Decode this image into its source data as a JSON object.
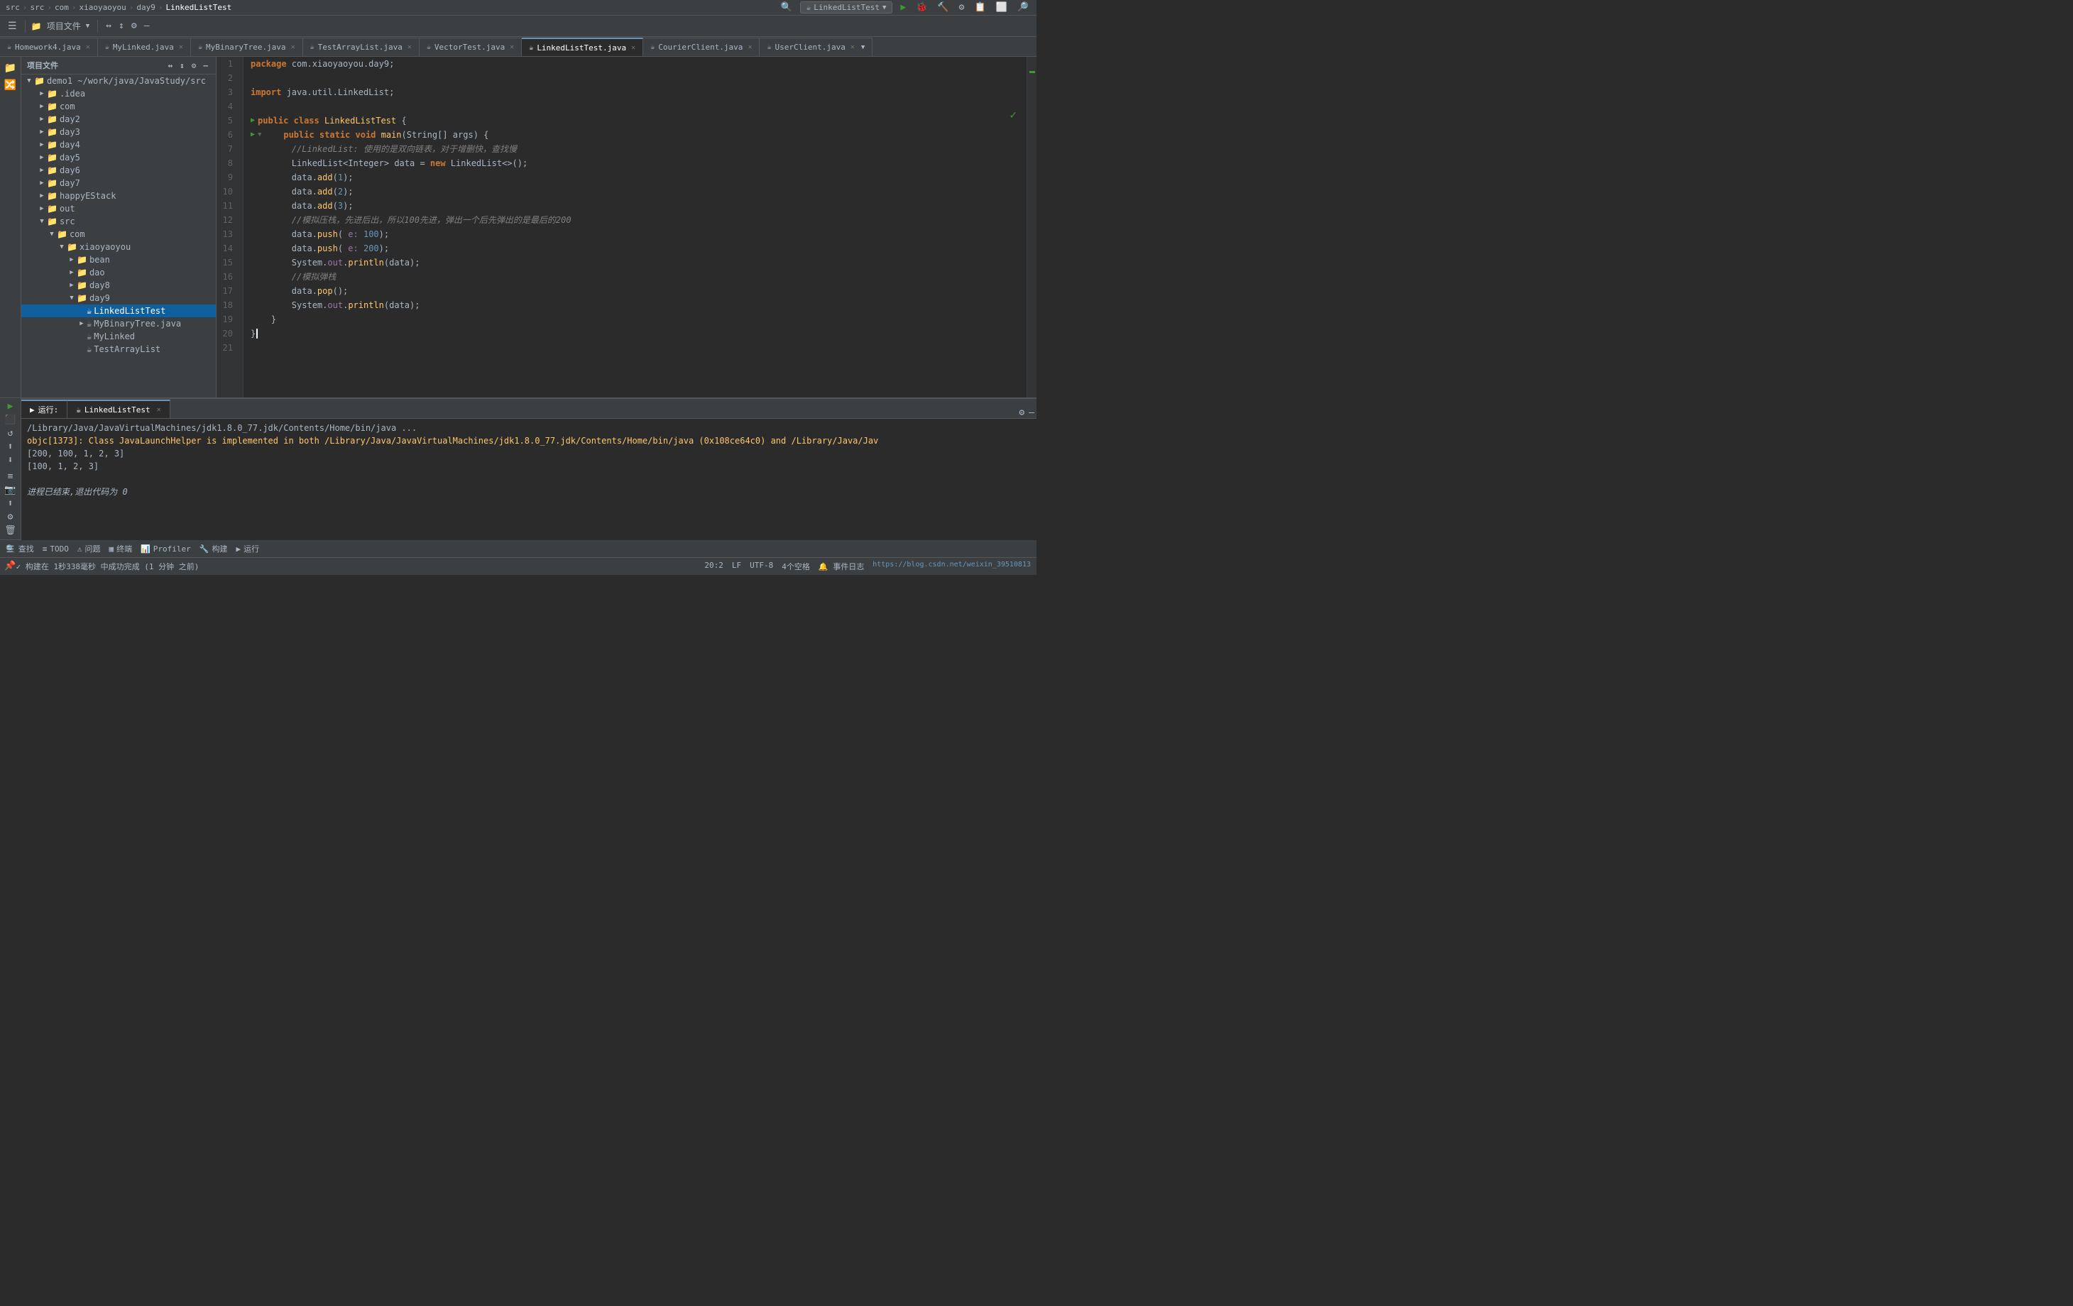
{
  "topbar": {
    "breadcrumb": [
      "src",
      "src",
      "com",
      "xiaoyaoyou",
      "day9",
      "LinkedListTest"
    ],
    "run_config": "LinkedListTest"
  },
  "toolbar": {
    "project_label": "项目文件",
    "buttons": [
      "≡",
      "↔",
      "↕",
      "⚙",
      "—"
    ]
  },
  "tabs": [
    {
      "label": "Homework4.java",
      "active": false,
      "icon": "☕"
    },
    {
      "label": "MyLinked.java",
      "active": false,
      "icon": "☕"
    },
    {
      "label": "MyBinaryTree.java",
      "active": false,
      "icon": "☕"
    },
    {
      "label": "TestArrayList.java",
      "active": false,
      "icon": "☕"
    },
    {
      "label": "VectorTest.java",
      "active": false,
      "icon": "☕"
    },
    {
      "label": "LinkedListTest.java",
      "active": true,
      "icon": "☕"
    },
    {
      "label": "CourierClient.java",
      "active": false,
      "icon": "☕"
    },
    {
      "label": "UserClient.java",
      "active": false,
      "icon": "☕"
    }
  ],
  "sidebar": {
    "title": "项目文件",
    "tree": [
      {
        "label": "demo1  ~/work/java/JavaStudy/src",
        "level": 0,
        "type": "project",
        "expanded": true
      },
      {
        "label": ".idea",
        "level": 1,
        "type": "folder",
        "expanded": false
      },
      {
        "label": "com",
        "level": 1,
        "type": "folder",
        "expanded": false
      },
      {
        "label": "day2",
        "level": 1,
        "type": "folder",
        "expanded": false
      },
      {
        "label": "day3",
        "level": 1,
        "type": "folder",
        "expanded": false
      },
      {
        "label": "day4",
        "level": 1,
        "type": "folder",
        "expanded": false
      },
      {
        "label": "day5",
        "level": 1,
        "type": "folder",
        "expanded": false
      },
      {
        "label": "day6",
        "level": 1,
        "type": "folder",
        "expanded": false
      },
      {
        "label": "day7",
        "level": 1,
        "type": "folder",
        "expanded": false
      },
      {
        "label": "happyEStack",
        "level": 1,
        "type": "folder",
        "expanded": false
      },
      {
        "label": "out",
        "level": 1,
        "type": "folder",
        "expanded": false
      },
      {
        "label": "src",
        "level": 1,
        "type": "folder",
        "expanded": true
      },
      {
        "label": "com",
        "level": 2,
        "type": "folder",
        "expanded": true
      },
      {
        "label": "xiaoyaoyou",
        "level": 3,
        "type": "folder",
        "expanded": true
      },
      {
        "label": "bean",
        "level": 4,
        "type": "folder",
        "expanded": false
      },
      {
        "label": "dao",
        "level": 4,
        "type": "folder",
        "expanded": false
      },
      {
        "label": "day8",
        "level": 4,
        "type": "folder",
        "expanded": false
      },
      {
        "label": "day9",
        "level": 4,
        "type": "folder",
        "expanded": true,
        "selected": false
      },
      {
        "label": "LinkedListTest",
        "level": 5,
        "type": "file-java",
        "expanded": false,
        "selected": true
      },
      {
        "label": "MyBinaryTree.java",
        "level": 5,
        "type": "file-java",
        "expanded": false
      },
      {
        "label": "MyLinked",
        "level": 5,
        "type": "file-java",
        "expanded": false
      },
      {
        "label": "TestArrayList",
        "level": 5,
        "type": "file-java",
        "expanded": false
      }
    ]
  },
  "code": {
    "lines": [
      {
        "num": 1,
        "content": "package com.xiaoyaoyou.day9;",
        "tokens": [
          {
            "t": "kw",
            "v": "package"
          },
          {
            "t": "var",
            "v": " com.xiaoyaoyou.day9"
          },
          {
            "t": "punc",
            "v": ";"
          }
        ]
      },
      {
        "num": 2,
        "content": ""
      },
      {
        "num": 3,
        "content": "import java.util.LinkedList;",
        "tokens": [
          {
            "t": "kw",
            "v": "import"
          },
          {
            "t": "var",
            "v": " java.util.LinkedList"
          },
          {
            "t": "punc",
            "v": ";"
          }
        ]
      },
      {
        "num": 4,
        "content": ""
      },
      {
        "num": 5,
        "content": "public class LinkedListTest {",
        "hasRunArrow": true,
        "tokens": [
          {
            "t": "kw",
            "v": "public"
          },
          {
            "t": "kw",
            "v": " class"
          },
          {
            "t": "cls-name",
            "v": " LinkedListTest"
          },
          {
            "t": "punc",
            "v": " {"
          }
        ]
      },
      {
        "num": 6,
        "content": "    public static void main(String[] args) {",
        "hasRunArrow": true,
        "hasFold": true,
        "tokens": [
          {
            "t": "kw",
            "v": "    public"
          },
          {
            "t": "kw",
            "v": " static"
          },
          {
            "t": "kw",
            "v": " void"
          },
          {
            "t": "fn",
            "v": " main"
          },
          {
            "t": "punc",
            "v": "("
          },
          {
            "t": "type",
            "v": "String"
          },
          {
            "t": "punc",
            "v": "[]"
          },
          {
            "t": "param",
            "v": " args"
          },
          {
            "t": "punc",
            "v": ") {"
          }
        ]
      },
      {
        "num": 7,
        "content": "        //LinkedList: 使用的是双向链表，对于增删快，查找慢",
        "tokens": [
          {
            "t": "cmt",
            "v": "        //LinkedList: 使用的是双向链表，对于增删快，查找慢"
          }
        ]
      },
      {
        "num": 8,
        "content": "        LinkedList<Integer> data = new LinkedList<>();",
        "tokens": [
          {
            "t": "type",
            "v": "        LinkedList"
          },
          {
            "t": "punc",
            "v": "<"
          },
          {
            "t": "type",
            "v": "Integer"
          },
          {
            "t": "punc",
            "v": ">"
          },
          {
            "t": "var",
            "v": " data"
          },
          {
            "t": "op",
            "v": " ="
          },
          {
            "t": "kw",
            "v": " new"
          },
          {
            "t": "type",
            "v": " LinkedList"
          },
          {
            "t": "punc",
            "v": "<>();"
          }
        ]
      },
      {
        "num": 9,
        "content": "        data.add(1);",
        "tokens": [
          {
            "t": "var",
            "v": "        data"
          },
          {
            "t": "punc",
            "v": "."
          },
          {
            "t": "fn",
            "v": "add"
          },
          {
            "t": "punc",
            "v": "("
          },
          {
            "t": "num",
            "v": "1"
          },
          {
            "t": "punc",
            "v": ");"
          }
        ]
      },
      {
        "num": 10,
        "content": "        data.add(2);",
        "tokens": [
          {
            "t": "var",
            "v": "        data"
          },
          {
            "t": "punc",
            "v": "."
          },
          {
            "t": "fn",
            "v": "add"
          },
          {
            "t": "punc",
            "v": "("
          },
          {
            "t": "num",
            "v": "2"
          },
          {
            "t": "punc",
            "v": ");"
          }
        ]
      },
      {
        "num": 11,
        "content": "        data.add(3);",
        "tokens": [
          {
            "t": "var",
            "v": "        data"
          },
          {
            "t": "punc",
            "v": "."
          },
          {
            "t": "fn",
            "v": "add"
          },
          {
            "t": "punc",
            "v": "("
          },
          {
            "t": "num",
            "v": "3"
          },
          {
            "t": "punc",
            "v": ");"
          }
        ]
      },
      {
        "num": 12,
        "content": "        //模拟压栈，先进后出，所以100先进，弹出一个后先弹出的是最后的200",
        "tokens": [
          {
            "t": "cmt",
            "v": "        //模拟压栈，先进后出，所以100先进，弹出一个后先弹出的是最后的200"
          }
        ]
      },
      {
        "num": 13,
        "content": "        data.push( e: 100);",
        "tokens": [
          {
            "t": "var",
            "v": "        data"
          },
          {
            "t": "punc",
            "v": "."
          },
          {
            "t": "fn",
            "v": "push"
          },
          {
            "t": "punc",
            "v": "("
          },
          {
            "t": "field",
            "v": " e:"
          },
          {
            "t": "num",
            "v": " 100"
          },
          {
            "t": "punc",
            "v": ");"
          }
        ]
      },
      {
        "num": 14,
        "content": "        data.push( e: 200);",
        "tokens": [
          {
            "t": "var",
            "v": "        data"
          },
          {
            "t": "punc",
            "v": "."
          },
          {
            "t": "fn",
            "v": "push"
          },
          {
            "t": "punc",
            "v": "("
          },
          {
            "t": "field",
            "v": " e:"
          },
          {
            "t": "num",
            "v": " 200"
          },
          {
            "t": "punc",
            "v": ");"
          }
        ]
      },
      {
        "num": 15,
        "content": "        System.out.println(data);",
        "tokens": [
          {
            "t": "type",
            "v": "        System"
          },
          {
            "t": "punc",
            "v": "."
          },
          {
            "t": "field",
            "v": "out"
          },
          {
            "t": "punc",
            "v": "."
          },
          {
            "t": "fn",
            "v": "println"
          },
          {
            "t": "punc",
            "v": "("
          },
          {
            "t": "var",
            "v": "data"
          },
          {
            "t": "punc",
            "v": ");"
          }
        ]
      },
      {
        "num": 16,
        "content": "        //模拟弹栈",
        "tokens": [
          {
            "t": "cmt",
            "v": "        //模拟弹栈"
          }
        ]
      },
      {
        "num": 17,
        "content": "        data.pop();",
        "tokens": [
          {
            "t": "var",
            "v": "        data"
          },
          {
            "t": "punc",
            "v": "."
          },
          {
            "t": "fn",
            "v": "pop"
          },
          {
            "t": "punc",
            "v": "();"
          }
        ]
      },
      {
        "num": 18,
        "content": "        System.out.println(data);",
        "tokens": [
          {
            "t": "type",
            "v": "        System"
          },
          {
            "t": "punc",
            "v": "."
          },
          {
            "t": "field",
            "v": "out"
          },
          {
            "t": "punc",
            "v": "."
          },
          {
            "t": "fn",
            "v": "println"
          },
          {
            "t": "punc",
            "v": "("
          },
          {
            "t": "var",
            "v": "data"
          },
          {
            "t": "punc",
            "v": ");"
          }
        ]
      },
      {
        "num": 19,
        "content": "    }",
        "tokens": [
          {
            "t": "punc",
            "v": "    }"
          }
        ]
      },
      {
        "num": 20,
        "content": "}",
        "tokens": [
          {
            "t": "punc",
            "v": "}"
          }
        ],
        "cursor": true
      },
      {
        "num": 21,
        "content": ""
      }
    ]
  },
  "bottom_panel": {
    "tabs": [
      {
        "label": "运行:",
        "active": true
      },
      {
        "label": "LinkedListTest",
        "active": true
      }
    ],
    "output": [
      {
        "type": "path",
        "text": "/Library/Java/JavaVirtualMachines/jdk1.8.0_77.jdk/Contents/Home/bin/java ..."
      },
      {
        "type": "warn",
        "text": "objc[1373]: Class JavaLaunchHelper is implemented in both /Library/Java/JavaVirtualMachines/jdk1.8.0_77.jdk/Contents/Home/bin/java (0x108ce64c0) and /Library/Java/Jav"
      },
      {
        "type": "normal",
        "text": "[200, 100, 1, 2, 3]"
      },
      {
        "type": "normal",
        "text": "[100, 1, 2, 3]"
      },
      {
        "type": "normal",
        "text": ""
      },
      {
        "type": "exit",
        "text": "进程已结束,退出代码为 0"
      }
    ]
  },
  "bottom_action_bar": {
    "items": [
      "🔍 查找",
      "≡ TODO",
      "⚠ 问题",
      "▦ 终端",
      "📊 Profiler",
      "🔧 构建",
      "▶ 运行"
    ]
  },
  "status_bar": {
    "left": "✓ 构建在 1秒338毫秒 中成功完成 (1 分钟 之前)",
    "right_items": [
      "20:2",
      "LF",
      "UTF-8",
      "4个空格",
      "事件日志"
    ]
  }
}
